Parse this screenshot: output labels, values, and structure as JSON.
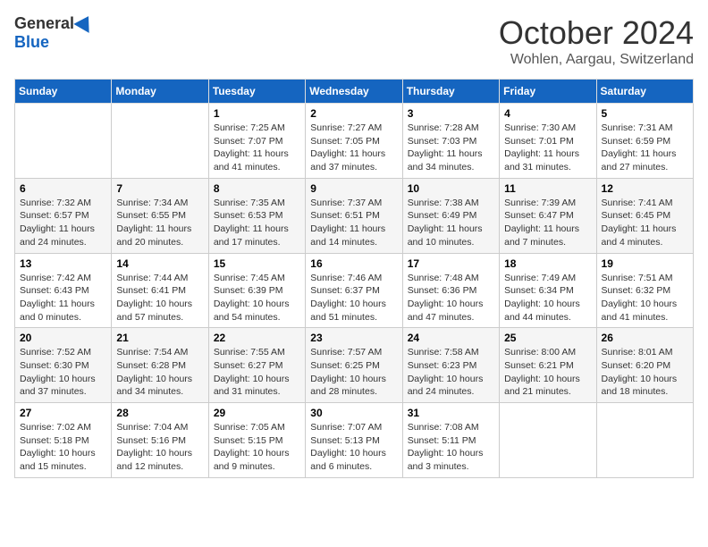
{
  "header": {
    "logo_general": "General",
    "logo_blue": "Blue",
    "month_title": "October 2024",
    "location": "Wohlen, Aargau, Switzerland"
  },
  "days_of_week": [
    "Sunday",
    "Monday",
    "Tuesday",
    "Wednesday",
    "Thursday",
    "Friday",
    "Saturday"
  ],
  "weeks": [
    [
      {
        "day": "",
        "info": ""
      },
      {
        "day": "",
        "info": ""
      },
      {
        "day": "1",
        "info": "Sunrise: 7:25 AM\nSunset: 7:07 PM\nDaylight: 11 hours and 41 minutes."
      },
      {
        "day": "2",
        "info": "Sunrise: 7:27 AM\nSunset: 7:05 PM\nDaylight: 11 hours and 37 minutes."
      },
      {
        "day": "3",
        "info": "Sunrise: 7:28 AM\nSunset: 7:03 PM\nDaylight: 11 hours and 34 minutes."
      },
      {
        "day": "4",
        "info": "Sunrise: 7:30 AM\nSunset: 7:01 PM\nDaylight: 11 hours and 31 minutes."
      },
      {
        "day": "5",
        "info": "Sunrise: 7:31 AM\nSunset: 6:59 PM\nDaylight: 11 hours and 27 minutes."
      }
    ],
    [
      {
        "day": "6",
        "info": "Sunrise: 7:32 AM\nSunset: 6:57 PM\nDaylight: 11 hours and 24 minutes."
      },
      {
        "day": "7",
        "info": "Sunrise: 7:34 AM\nSunset: 6:55 PM\nDaylight: 11 hours and 20 minutes."
      },
      {
        "day": "8",
        "info": "Sunrise: 7:35 AM\nSunset: 6:53 PM\nDaylight: 11 hours and 17 minutes."
      },
      {
        "day": "9",
        "info": "Sunrise: 7:37 AM\nSunset: 6:51 PM\nDaylight: 11 hours and 14 minutes."
      },
      {
        "day": "10",
        "info": "Sunrise: 7:38 AM\nSunset: 6:49 PM\nDaylight: 11 hours and 10 minutes."
      },
      {
        "day": "11",
        "info": "Sunrise: 7:39 AM\nSunset: 6:47 PM\nDaylight: 11 hours and 7 minutes."
      },
      {
        "day": "12",
        "info": "Sunrise: 7:41 AM\nSunset: 6:45 PM\nDaylight: 11 hours and 4 minutes."
      }
    ],
    [
      {
        "day": "13",
        "info": "Sunrise: 7:42 AM\nSunset: 6:43 PM\nDaylight: 11 hours and 0 minutes."
      },
      {
        "day": "14",
        "info": "Sunrise: 7:44 AM\nSunset: 6:41 PM\nDaylight: 10 hours and 57 minutes."
      },
      {
        "day": "15",
        "info": "Sunrise: 7:45 AM\nSunset: 6:39 PM\nDaylight: 10 hours and 54 minutes."
      },
      {
        "day": "16",
        "info": "Sunrise: 7:46 AM\nSunset: 6:37 PM\nDaylight: 10 hours and 51 minutes."
      },
      {
        "day": "17",
        "info": "Sunrise: 7:48 AM\nSunset: 6:36 PM\nDaylight: 10 hours and 47 minutes."
      },
      {
        "day": "18",
        "info": "Sunrise: 7:49 AM\nSunset: 6:34 PM\nDaylight: 10 hours and 44 minutes."
      },
      {
        "day": "19",
        "info": "Sunrise: 7:51 AM\nSunset: 6:32 PM\nDaylight: 10 hours and 41 minutes."
      }
    ],
    [
      {
        "day": "20",
        "info": "Sunrise: 7:52 AM\nSunset: 6:30 PM\nDaylight: 10 hours and 37 minutes."
      },
      {
        "day": "21",
        "info": "Sunrise: 7:54 AM\nSunset: 6:28 PM\nDaylight: 10 hours and 34 minutes."
      },
      {
        "day": "22",
        "info": "Sunrise: 7:55 AM\nSunset: 6:27 PM\nDaylight: 10 hours and 31 minutes."
      },
      {
        "day": "23",
        "info": "Sunrise: 7:57 AM\nSunset: 6:25 PM\nDaylight: 10 hours and 28 minutes."
      },
      {
        "day": "24",
        "info": "Sunrise: 7:58 AM\nSunset: 6:23 PM\nDaylight: 10 hours and 24 minutes."
      },
      {
        "day": "25",
        "info": "Sunrise: 8:00 AM\nSunset: 6:21 PM\nDaylight: 10 hours and 21 minutes."
      },
      {
        "day": "26",
        "info": "Sunrise: 8:01 AM\nSunset: 6:20 PM\nDaylight: 10 hours and 18 minutes."
      }
    ],
    [
      {
        "day": "27",
        "info": "Sunrise: 7:02 AM\nSunset: 5:18 PM\nDaylight: 10 hours and 15 minutes."
      },
      {
        "day": "28",
        "info": "Sunrise: 7:04 AM\nSunset: 5:16 PM\nDaylight: 10 hours and 12 minutes."
      },
      {
        "day": "29",
        "info": "Sunrise: 7:05 AM\nSunset: 5:15 PM\nDaylight: 10 hours and 9 minutes."
      },
      {
        "day": "30",
        "info": "Sunrise: 7:07 AM\nSunset: 5:13 PM\nDaylight: 10 hours and 6 minutes."
      },
      {
        "day": "31",
        "info": "Sunrise: 7:08 AM\nSunset: 5:11 PM\nDaylight: 10 hours and 3 minutes."
      },
      {
        "day": "",
        "info": ""
      },
      {
        "day": "",
        "info": ""
      }
    ]
  ]
}
